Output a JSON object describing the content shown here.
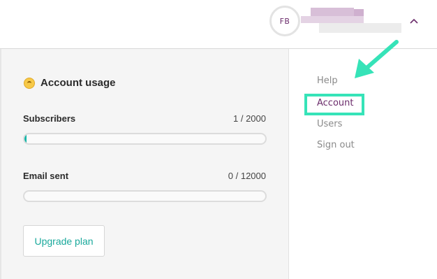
{
  "header": {
    "avatar_initials": "FB",
    "colors": {
      "avatar_text": "#6b2c6b",
      "chevron": "#6b2c6b"
    }
  },
  "usage": {
    "title": "Account usage",
    "subscribers": {
      "label": "Subscribers",
      "value_text": "1 / 2000",
      "fraction": 0.0005
    },
    "emails": {
      "label": "Email sent",
      "value_text": "0 / 12000",
      "fraction": 0
    },
    "upgrade_label": "Upgrade plan"
  },
  "menu": {
    "items": [
      {
        "label": "Help",
        "active": false
      },
      {
        "label": "Account",
        "active": true
      },
      {
        "label": "Users",
        "active": false
      },
      {
        "label": "Sign out",
        "active": false
      }
    ]
  },
  "annotation": {
    "highlight_color": "#36e3b8",
    "highlighted_item": "Account"
  },
  "colors": {
    "accent": "#17b6a8",
    "panel_bg": "#f5f5f5"
  }
}
